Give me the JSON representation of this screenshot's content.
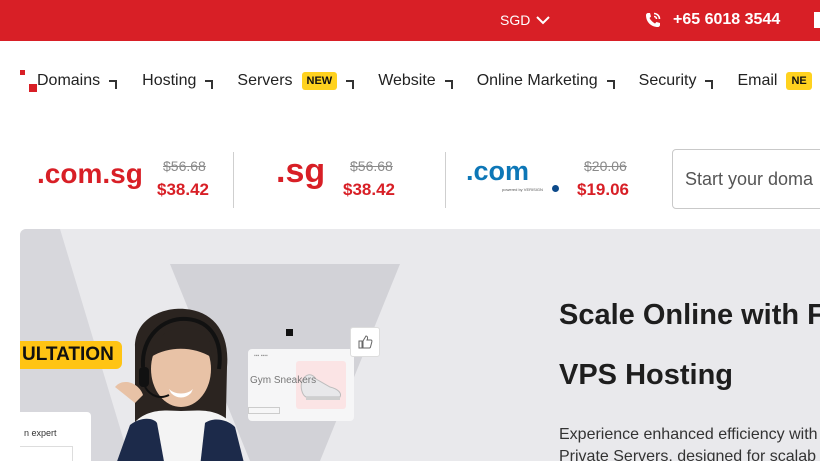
{
  "topbar": {
    "currency": "SGD",
    "phone": "+65 6018 3544"
  },
  "nav": {
    "items": [
      {
        "label": "Domains",
        "badge": ""
      },
      {
        "label": "Hosting",
        "badge": ""
      },
      {
        "label": "Servers",
        "badge": "NEW"
      },
      {
        "label": "Website",
        "badge": ""
      },
      {
        "label": "Online Marketing",
        "badge": ""
      },
      {
        "label": "Security",
        "badge": ""
      },
      {
        "label": "Email",
        "badge": "NE"
      }
    ]
  },
  "domains": [
    {
      "name": ".com.sg",
      "old_price": "$56.68",
      "new_price": "$38.42"
    },
    {
      "name": ".sg",
      "old_price": "$56.68",
      "new_price": "$38.42"
    },
    {
      "name": ".com",
      "sublabel": "powered by VERISIGN",
      "old_price": "$20.06",
      "new_price": "$19.06"
    }
  ],
  "search": {
    "placeholder": "Start your doma"
  },
  "hero": {
    "badge": "ULTATION",
    "card_text": "n expert",
    "mock_text": "Gym Sneakers",
    "title_line1": "Scale Online with F",
    "title_line2": "VPS Hosting",
    "paragraph_line1": "Experience enhanced efficiency with",
    "paragraph_line2": "Private Servers, designed for scalab"
  },
  "colors": {
    "brand_red": "#d81f26",
    "badge_yellow": "#ffd21f",
    "com_blue": "#0d77b7"
  }
}
